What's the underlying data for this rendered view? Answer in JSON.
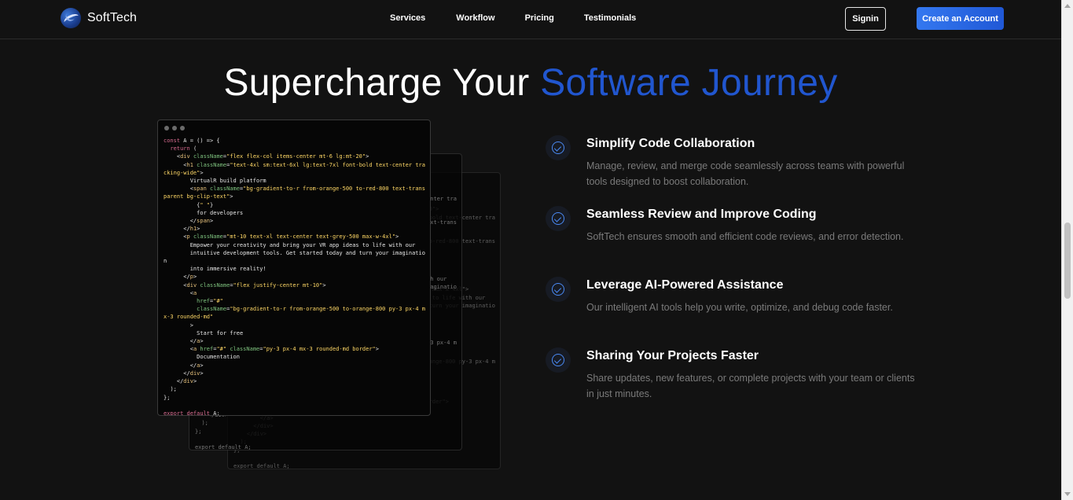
{
  "brand": {
    "name": "SoftTech"
  },
  "nav": {
    "links": [
      "Services",
      "Workflow",
      "Pricing",
      "Testimonials"
    ],
    "signin_label": "Signin",
    "create_label": "Create an Account"
  },
  "hero": {
    "title_plain": "Supercharge Your ",
    "title_accent": "Software Journey"
  },
  "colors": {
    "accent": "#2156cf",
    "button": "#2f6ee8",
    "check": "#4a8af5",
    "background": "#121212"
  },
  "code_sample": {
    "lines": [
      "const A = () => {",
      "  return (",
      "    <div className=\"flex flex-col items-center mt-6 lg:mt-20\">",
      "      <h1 className=\"text-4xl sm:text-6xl lg:text-7xl font-bold text-center tracking-wide\">",
      "        VirtualR build platform",
      "        <span className=\"bg-gradient-to-r from-orange-500 to-red-800 text-transparent bg-clip-text\">",
      "          {\" \"}",
      "          for developers",
      "        </span>",
      "      </h1>",
      "      <p className=\"mt-10 text-xl text-center text-grey-500 max-w-4xl\">",
      "        Empower your creativity and bring your VR app ideas to life with our",
      "        intuitive development tools. Get started today and turn your imagination",
      "        into immersive reality!",
      "      </p>",
      "      <div className=\"flex justify-center mt-10\">",
      "        <a",
      "          href=\"#\"",
      "          className=\"bg-gradient-to-r from-orange-500 to-orange-800 py-3 px-4 mx-3 rounded-md\"",
      "        >",
      "          Start for free",
      "        </a>",
      "        <a href=\"#\" className=\"py-3 px-4 mx-3 rounded-md border\">",
      "          Documentation",
      "        </a>",
      "      </div>",
      "    </div>",
      "  );",
      "};",
      "",
      "export default A;"
    ]
  },
  "features": [
    {
      "icon": "check-circle-icon",
      "title": "Simplify Code Collaboration",
      "description": "Manage, review, and merge code seamlessly across teams with powerful tools designed to boost collaboration."
    },
    {
      "icon": "check-circle-icon",
      "title": "Seamless Review and Improve Coding",
      "description": "SoftTech ensures smooth and efficient code reviews, and error detection."
    },
    {
      "icon": "check-circle-icon",
      "title": "Leverage AI-Powered Assistance",
      "description": "Our intelligent AI tools help you write, optimize, and debug code faster."
    },
    {
      "icon": "check-circle-icon",
      "title": "Sharing Your Projects Faster",
      "description": "Share updates, new features, or complete projects with your team or clients in just minutes."
    }
  ]
}
